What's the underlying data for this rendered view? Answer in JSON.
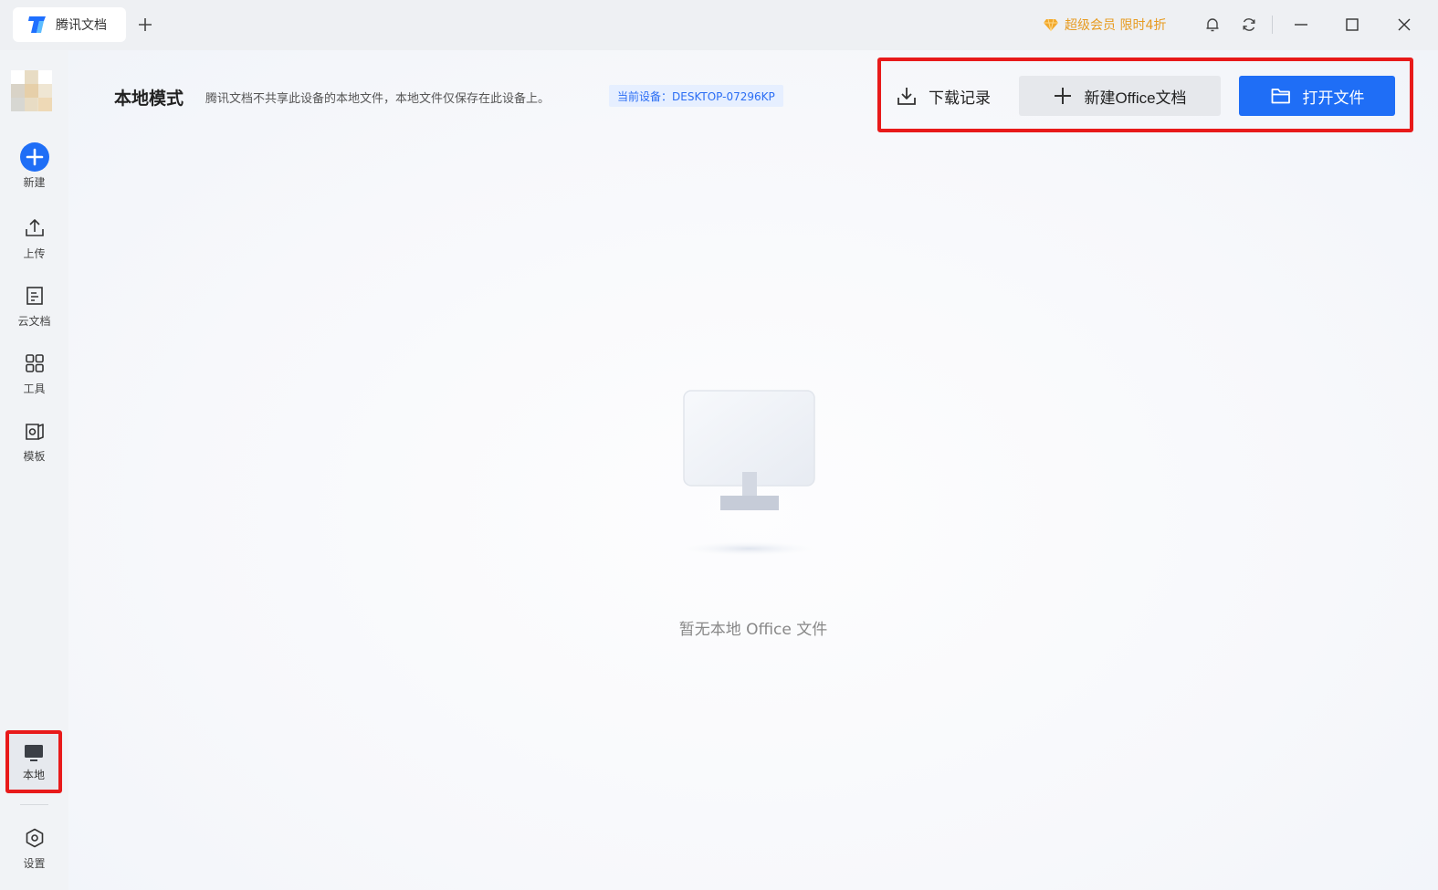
{
  "titlebar": {
    "tab_label": "腾讯文档",
    "vip_label": "超级会员 限时4折"
  },
  "sidebar": {
    "items": [
      {
        "label": "新建",
        "icon": "plus-circle-icon"
      },
      {
        "label": "上传",
        "icon": "upload-icon"
      },
      {
        "label": "云文档",
        "icon": "document-icon"
      },
      {
        "label": "工具",
        "icon": "grid-icon"
      },
      {
        "label": "模板",
        "icon": "template-icon"
      }
    ],
    "local_label": "本地",
    "settings_label": "设置"
  },
  "main": {
    "title": "本地模式",
    "description": "腾讯文档不共享此设备的本地文件，本地文件仅保存在此设备上。",
    "device": "当前设备：DESKTOP-07296KP",
    "download_label": "下载记录",
    "new_office_label": "新建Office文档",
    "open_file_label": "打开文件",
    "empty_text": "暂无本地 Office 文件"
  },
  "colors": {
    "accent": "#1f6ef6",
    "highlight": "#e81a1a",
    "vip": "#e79b21"
  }
}
